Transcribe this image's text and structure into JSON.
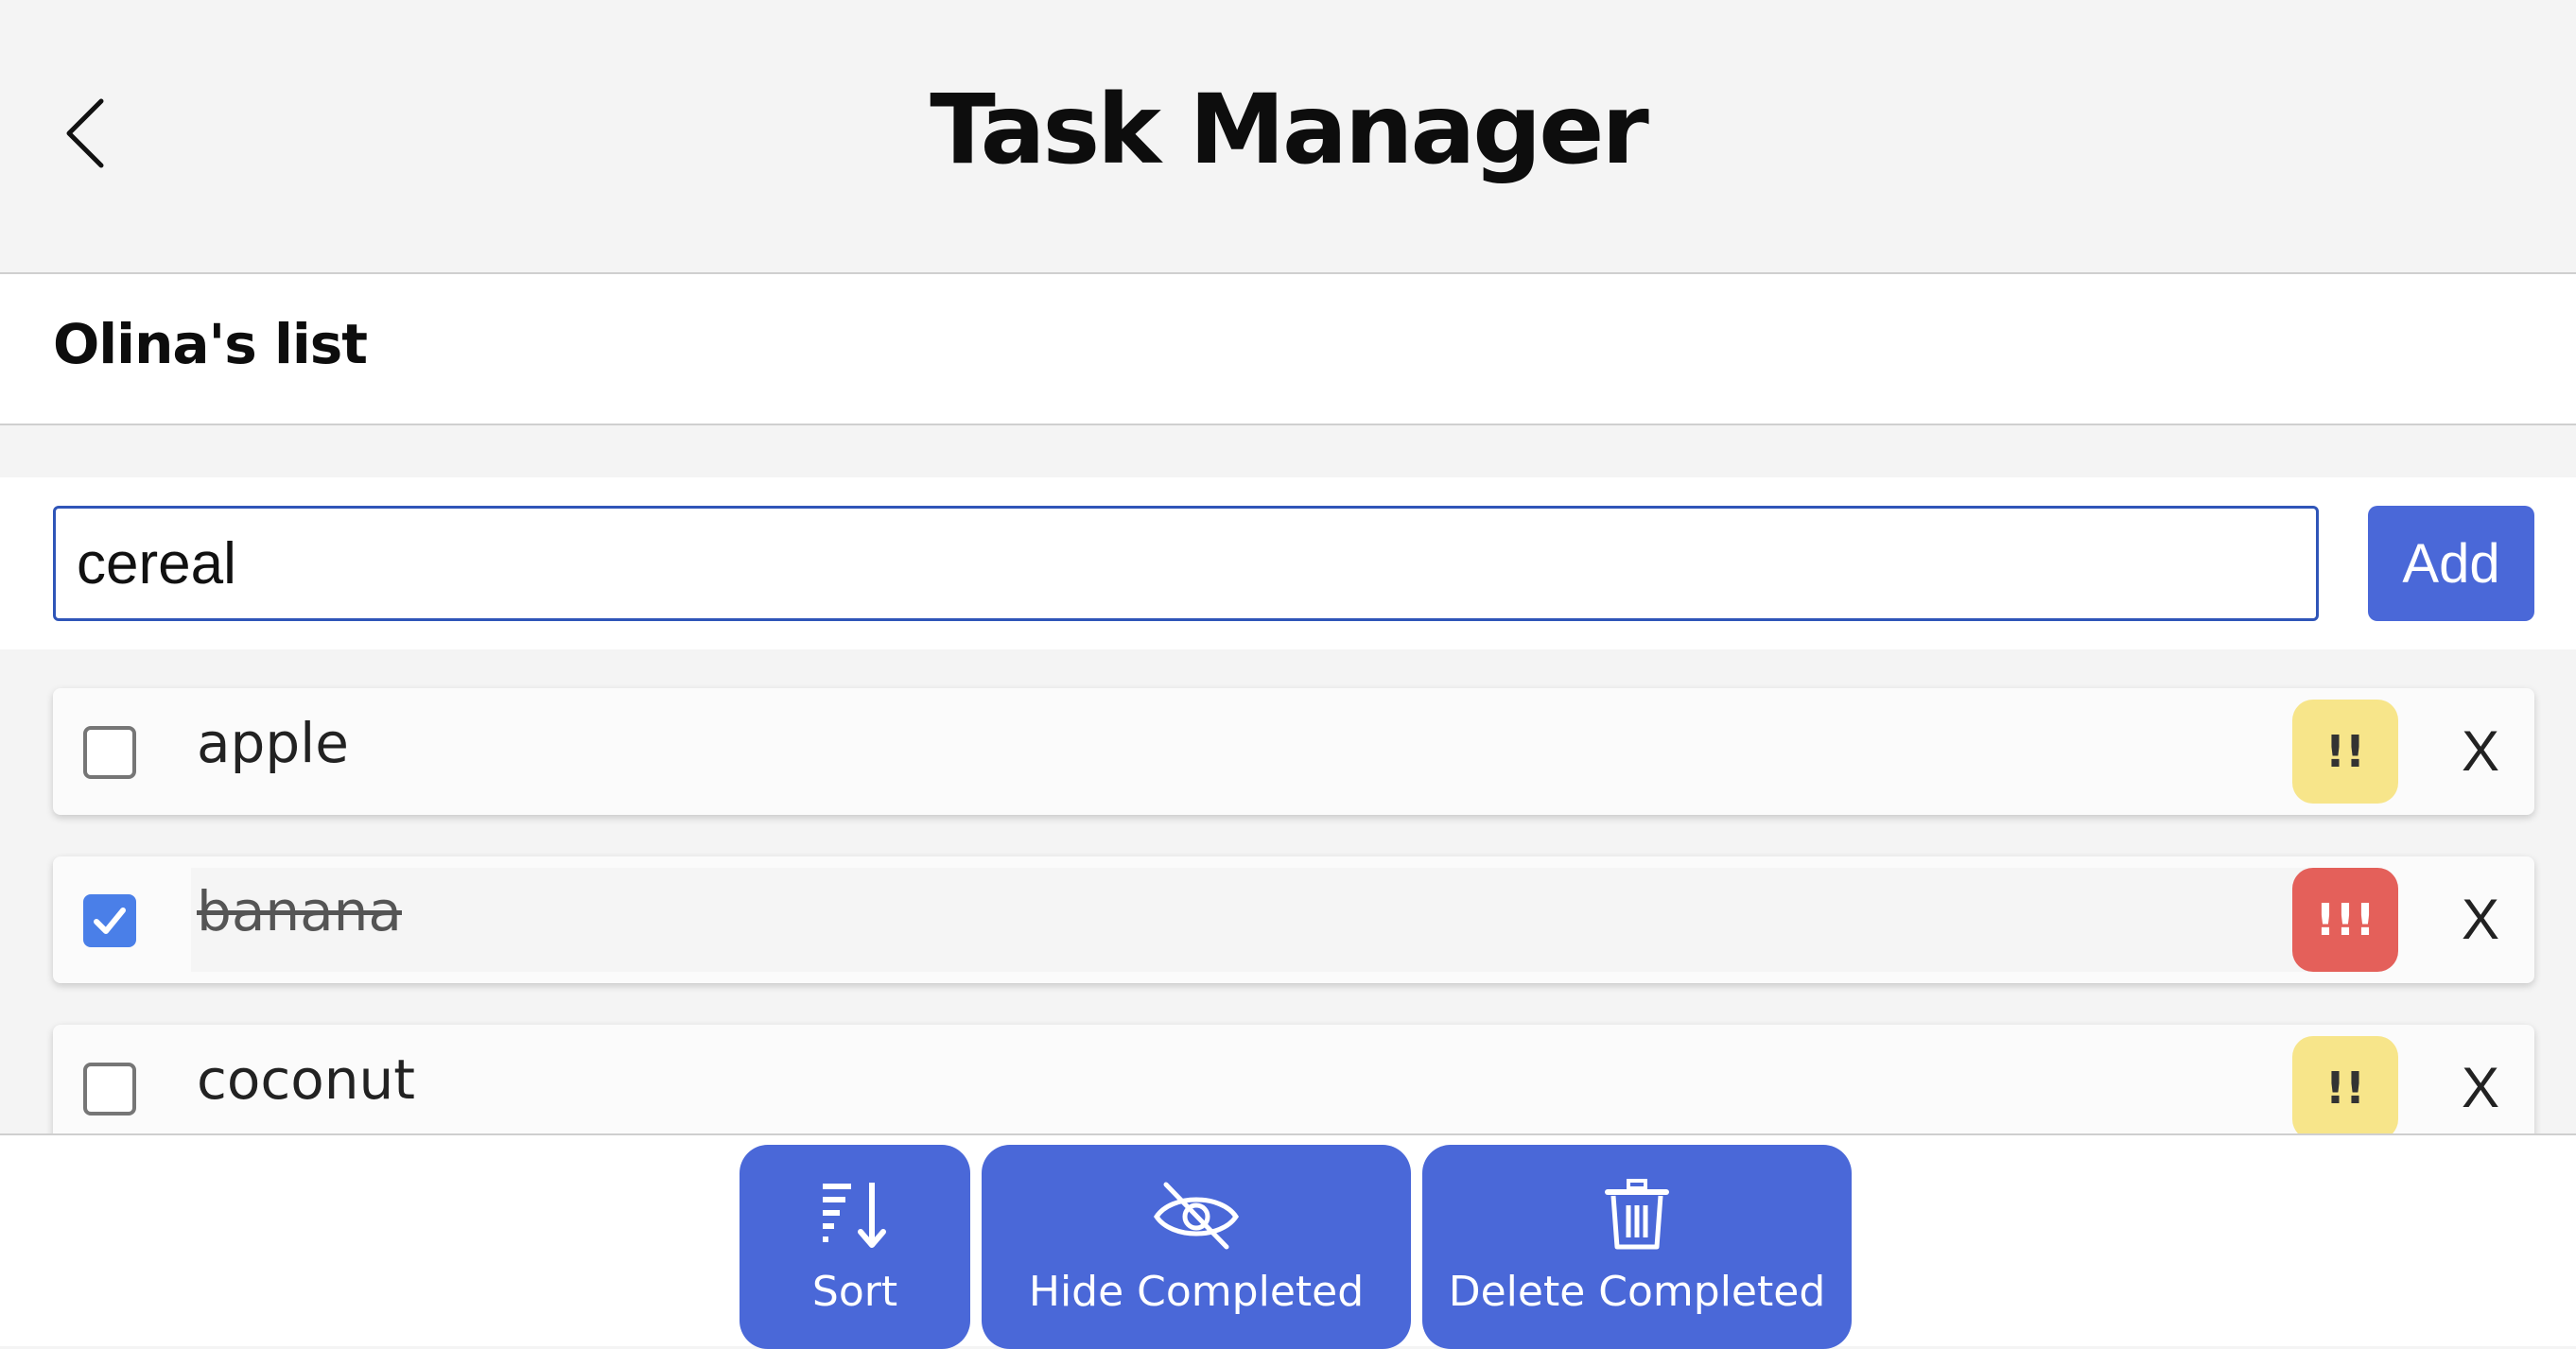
{
  "header": {
    "title": "Task Manager",
    "back_icon": "chevron-left-icon"
  },
  "list": {
    "name": "Olina's list"
  },
  "add_form": {
    "input_value": "cereal",
    "add_label": "Add"
  },
  "tasks": [
    {
      "label": "apple",
      "completed": false,
      "priority": "!!",
      "priority_color": "#f7e58a",
      "priority_text_color": "#333333",
      "delete_label": "X"
    },
    {
      "label": "banana",
      "completed": true,
      "priority": "!!!",
      "priority_color": "#e4605a",
      "priority_text_color": "#ffffff",
      "delete_label": "X"
    },
    {
      "label": "coconut",
      "completed": false,
      "priority": "!!",
      "priority_color": "#f7e58a",
      "priority_text_color": "#333333",
      "delete_label": "X"
    }
  ],
  "footer": {
    "sort_label": "Sort",
    "hide_completed_label": "Hide Completed",
    "delete_completed_label": "Delete Completed"
  },
  "colors": {
    "accent": "#4a68d8",
    "checkbox_checked": "#4a7fe8"
  }
}
